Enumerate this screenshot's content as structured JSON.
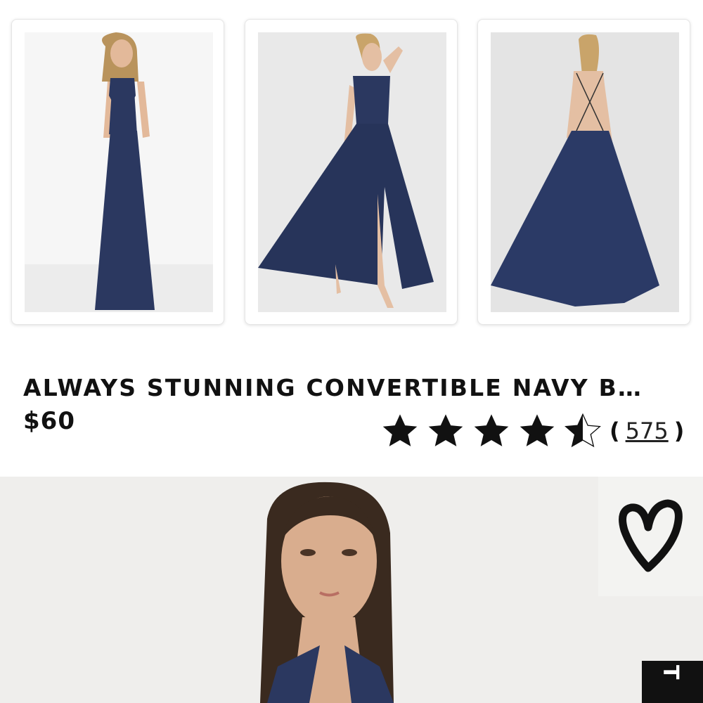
{
  "product": {
    "title": "ALWAYS STUNNING CONVERTIBLE NAVY B…",
    "price": "$60",
    "rating": 4.5,
    "rating_max": 5,
    "review_count": "575",
    "paren_open": "(",
    "paren_close": ")"
  },
  "thumbnails": [
    {
      "name": "front-view"
    },
    {
      "name": "slit-view"
    },
    {
      "name": "back-view"
    }
  ],
  "side_tab": {
    "label": "T"
  },
  "icons": {
    "wishlist": "heart-icon",
    "star": "star-icon"
  },
  "colors": {
    "dress": "#2b3860",
    "accent": "#111111",
    "background": "#ffffff"
  }
}
